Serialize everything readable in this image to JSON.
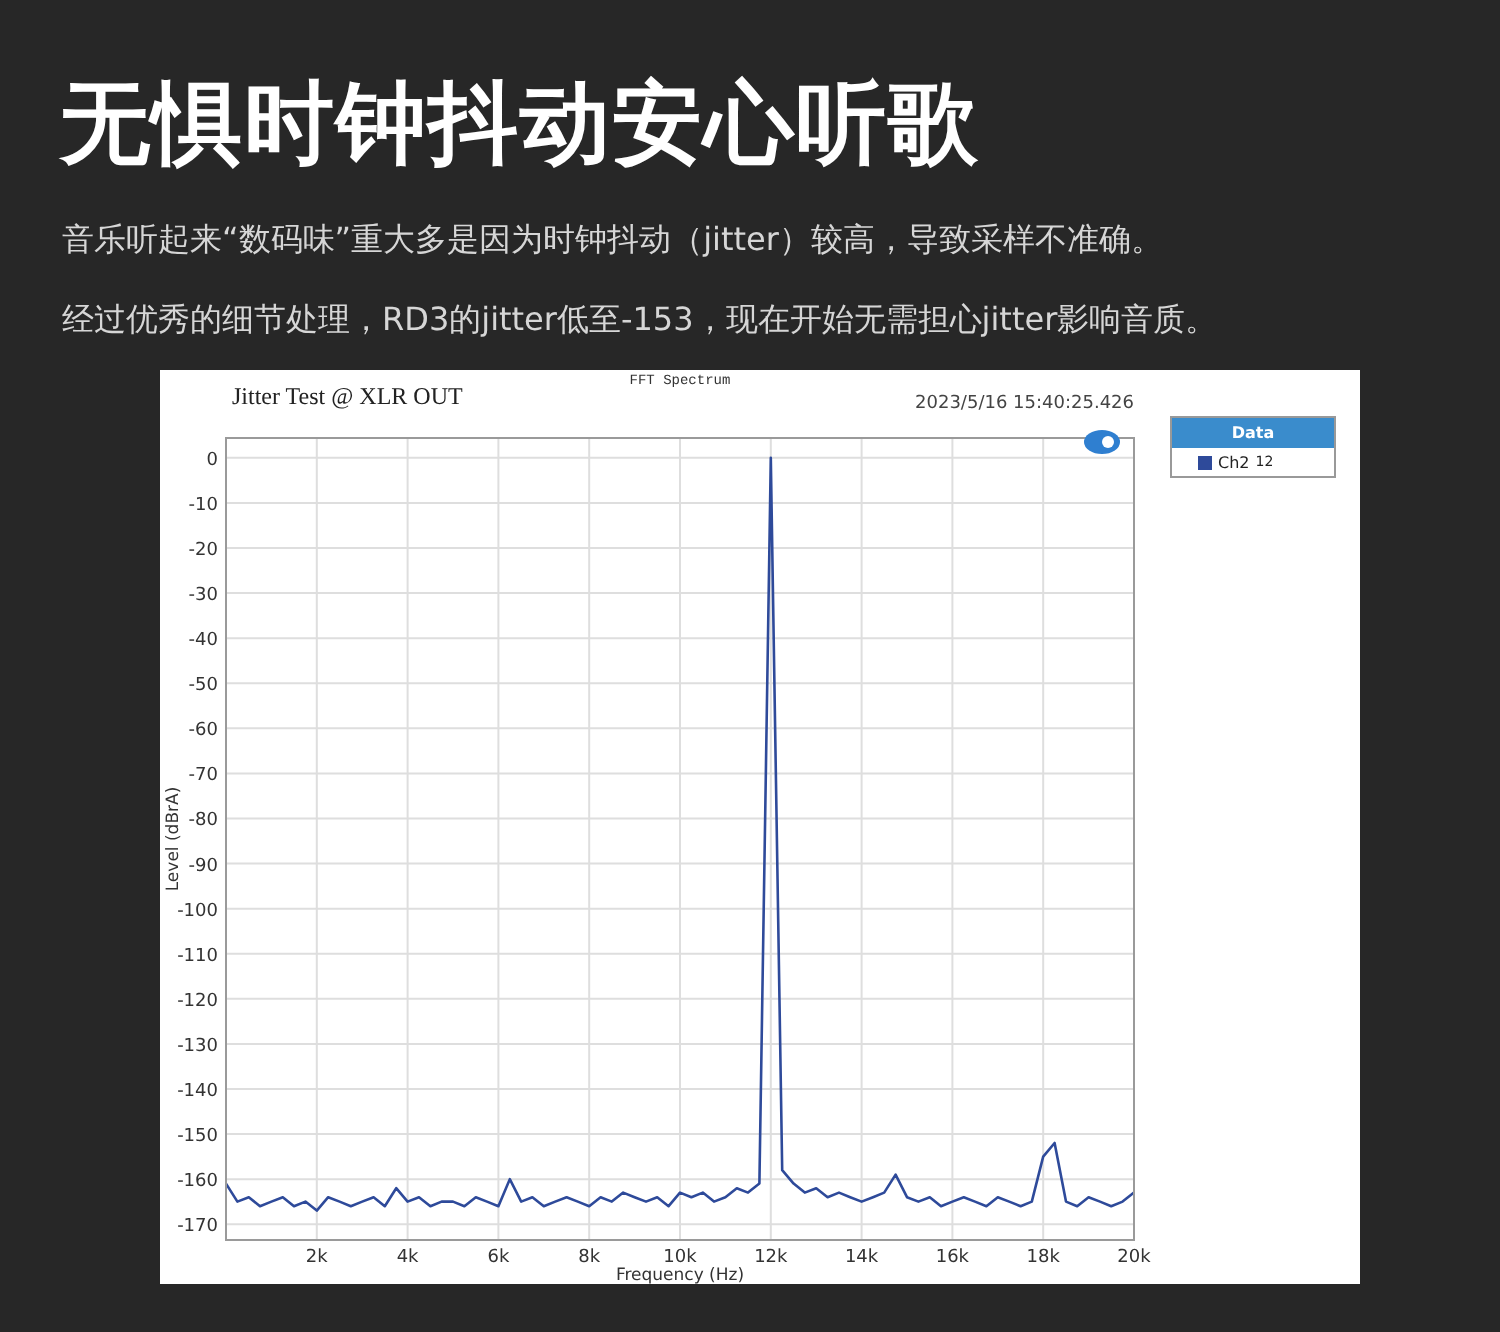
{
  "headline": "无惧时钟抖动安心听歌",
  "paragraphs": [
    "音乐听起来“数码味”重大多是因为时钟抖动（jitter）较高，导致采样不准确。",
    "经过优秀的细节处理，RD3的jitter低至-153，现在开始无需担心jitter影响音质。"
  ],
  "chart_panel": {
    "subtitle": "FFT Spectrum",
    "title": "Jitter Test @ XLR OUT",
    "timestamp": "2023/5/16 15:40:25.426",
    "legend": {
      "title": "Data",
      "items": [
        {
          "value": "12"
        }
      ]
    },
    "chart_data": {
      "type": "line",
      "grid": true,
      "xlabel": "Frequency (Hz)",
      "ylabel": "Level (dBrA)",
      "xlim": [
        0,
        20000
      ],
      "ylim": [
        -173.5,
        4.4
      ],
      "xticks": [
        {
          "value": 2000,
          "label": "2k"
        },
        {
          "value": 4000,
          "label": "4k"
        },
        {
          "value": 6000,
          "label": "6k"
        },
        {
          "value": 8000,
          "label": "8k"
        },
        {
          "value": 10000,
          "label": "10k"
        },
        {
          "value": 12000,
          "label": "12k"
        },
        {
          "value": 14000,
          "label": "14k"
        },
        {
          "value": 16000,
          "label": "16k"
        },
        {
          "value": 18000,
          "label": "18k"
        },
        {
          "value": 20000,
          "label": "20k"
        }
      ],
      "yticks": [
        0,
        -10,
        -20,
        -30,
        -40,
        -50,
        -60,
        -70,
        -80,
        -90,
        -100,
        -110,
        -120,
        -130,
        -140,
        -150,
        -160,
        -170
      ],
      "x": [
        0,
        250,
        500,
        750,
        1000,
        1250,
        1500,
        1750,
        2000,
        2250,
        2500,
        2750,
        3000,
        3250,
        3500,
        3750,
        4000,
        4250,
        4500,
        4750,
        5000,
        5250,
        5500,
        5750,
        6000,
        6250,
        6500,
        6750,
        7000,
        7250,
        7500,
        7750,
        8000,
        8250,
        8500,
        8750,
        9000,
        9250,
        9500,
        9750,
        10000,
        10250,
        10500,
        10750,
        11000,
        11250,
        11500,
        11750,
        12000,
        12250,
        12500,
        12750,
        13000,
        13250,
        13500,
        13750,
        14000,
        14250,
        14500,
        14750,
        15000,
        15250,
        15500,
        15750,
        16000,
        16250,
        16500,
        16750,
        17000,
        17250,
        17500,
        17750,
        18000,
        18250,
        18500,
        18750,
        19000,
        19250,
        19500,
        19750,
        20000
      ],
      "series": [
        {
          "name": "Ch2",
          "color": "#2e4a9a",
          "values": [
            -161,
            -165,
            -164,
            -166,
            -165,
            -164,
            -166,
            -165,
            -167,
            -164,
            -165,
            -166,
            -165,
            -164,
            -166,
            -162,
            -165,
            -164,
            -166,
            -165,
            -165,
            -166,
            -164,
            -165,
            -166,
            -160,
            -165,
            -164,
            -166,
            -165,
            -164,
            -165,
            -166,
            -164,
            -165,
            -163,
            -164,
            -165,
            -164,
            -166,
            -163,
            -164,
            -163,
            -165,
            -164,
            -162,
            -163,
            -161,
            0,
            -158,
            -161,
            -163,
            -162,
            -164,
            -163,
            -164,
            -165,
            -164,
            -163,
            -159,
            -164,
            -165,
            -164,
            -166,
            -165,
            -164,
            -165,
            -166,
            -164,
            -165,
            -166,
            -165,
            -155,
            -152,
            -165,
            -166,
            -164,
            -165,
            -166,
            -165,
            -163
          ]
        }
      ]
    }
  }
}
